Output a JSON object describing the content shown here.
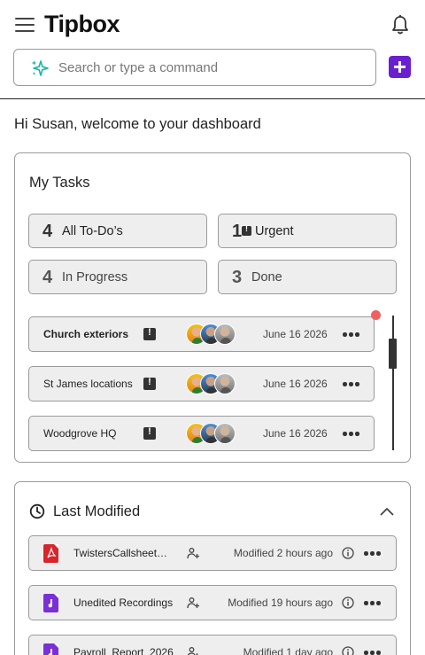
{
  "app": {
    "name": "Tipbox"
  },
  "search": {
    "placeholder": "Search or type a command"
  },
  "welcome": "Hi Susan, welcome to your dashboard",
  "tasks_card": {
    "title": "My Tasks",
    "stats": [
      {
        "count": "4",
        "label": "All To-Do’s"
      },
      {
        "count": "1",
        "label": "Urgent"
      },
      {
        "count": "4",
        "label": "In Progress"
      },
      {
        "count": "3",
        "label": "Done"
      }
    ],
    "items": [
      {
        "name": "Church exteriors",
        "date": "June 16 2026",
        "urgent": true
      },
      {
        "name": "St James locations",
        "date": "June 16 2026",
        "urgent": true
      },
      {
        "name": "Woodgrove HQ",
        "date": "June 16 2026",
        "urgent": true
      }
    ]
  },
  "modified_card": {
    "title": "Last Modified",
    "files": [
      {
        "name": "TwistersCallsheet_...",
        "type": "pdf",
        "modified": "Modified 2 hours ago"
      },
      {
        "name": "Unedited Recordings",
        "type": "media",
        "modified": "Modified 19 hours ago"
      },
      {
        "name": "Payroll_Report_2026",
        "type": "media",
        "modified": "Modified 1 day ago"
      }
    ]
  },
  "colors": {
    "accent": "#6a1fd0",
    "pdf": "#d7262b",
    "media": "#7b2fd6",
    "notification": "#f06060",
    "spark": "#14b8a6"
  }
}
